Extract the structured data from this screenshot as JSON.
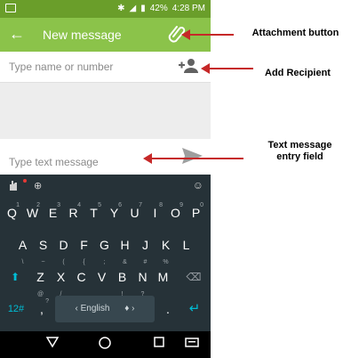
{
  "status_bar": {
    "battery": "42%",
    "time": "4:28 PM"
  },
  "app_bar": {
    "title": "New message"
  },
  "recipient": {
    "placeholder": "Type name or number"
  },
  "compose": {
    "placeholder": "Type text message"
  },
  "keyboard": {
    "row1": [
      "Q",
      "W",
      "E",
      "R",
      "T",
      "Y",
      "U",
      "I",
      "O",
      "P"
    ],
    "row1_hints": [
      "1",
      "2",
      "3",
      "4",
      "5",
      "6",
      "7",
      "8",
      "9",
      "0"
    ],
    "row2": [
      "A",
      "S",
      "D",
      "F",
      "G",
      "H",
      "J",
      "K",
      "L"
    ],
    "row2_hints": [
      "\\",
      "~",
      "(",
      "{",
      ";",
      "&",
      "#",
      "%",
      ""
    ],
    "row3": [
      "Z",
      "X",
      "C",
      "V",
      "B",
      "N",
      "M"
    ],
    "row3_hints": [
      "@",
      "/",
      "",
      "",
      "!",
      "?",
      ""
    ],
    "symbols_key": "12#",
    "comma_key": ",",
    "comma_hint": "?",
    "space_label": "English",
    "period_key": "."
  },
  "annotations": {
    "attachment": "Attachment button",
    "add_recipient": "Add Recipient",
    "text_entry": "Text message entry field"
  },
  "colors": {
    "app_bar": "#8bc34a",
    "status_bar": "#6a9e2a",
    "keyboard": "#263238",
    "arrow": "#c62828",
    "accent": "#00bcd4"
  }
}
